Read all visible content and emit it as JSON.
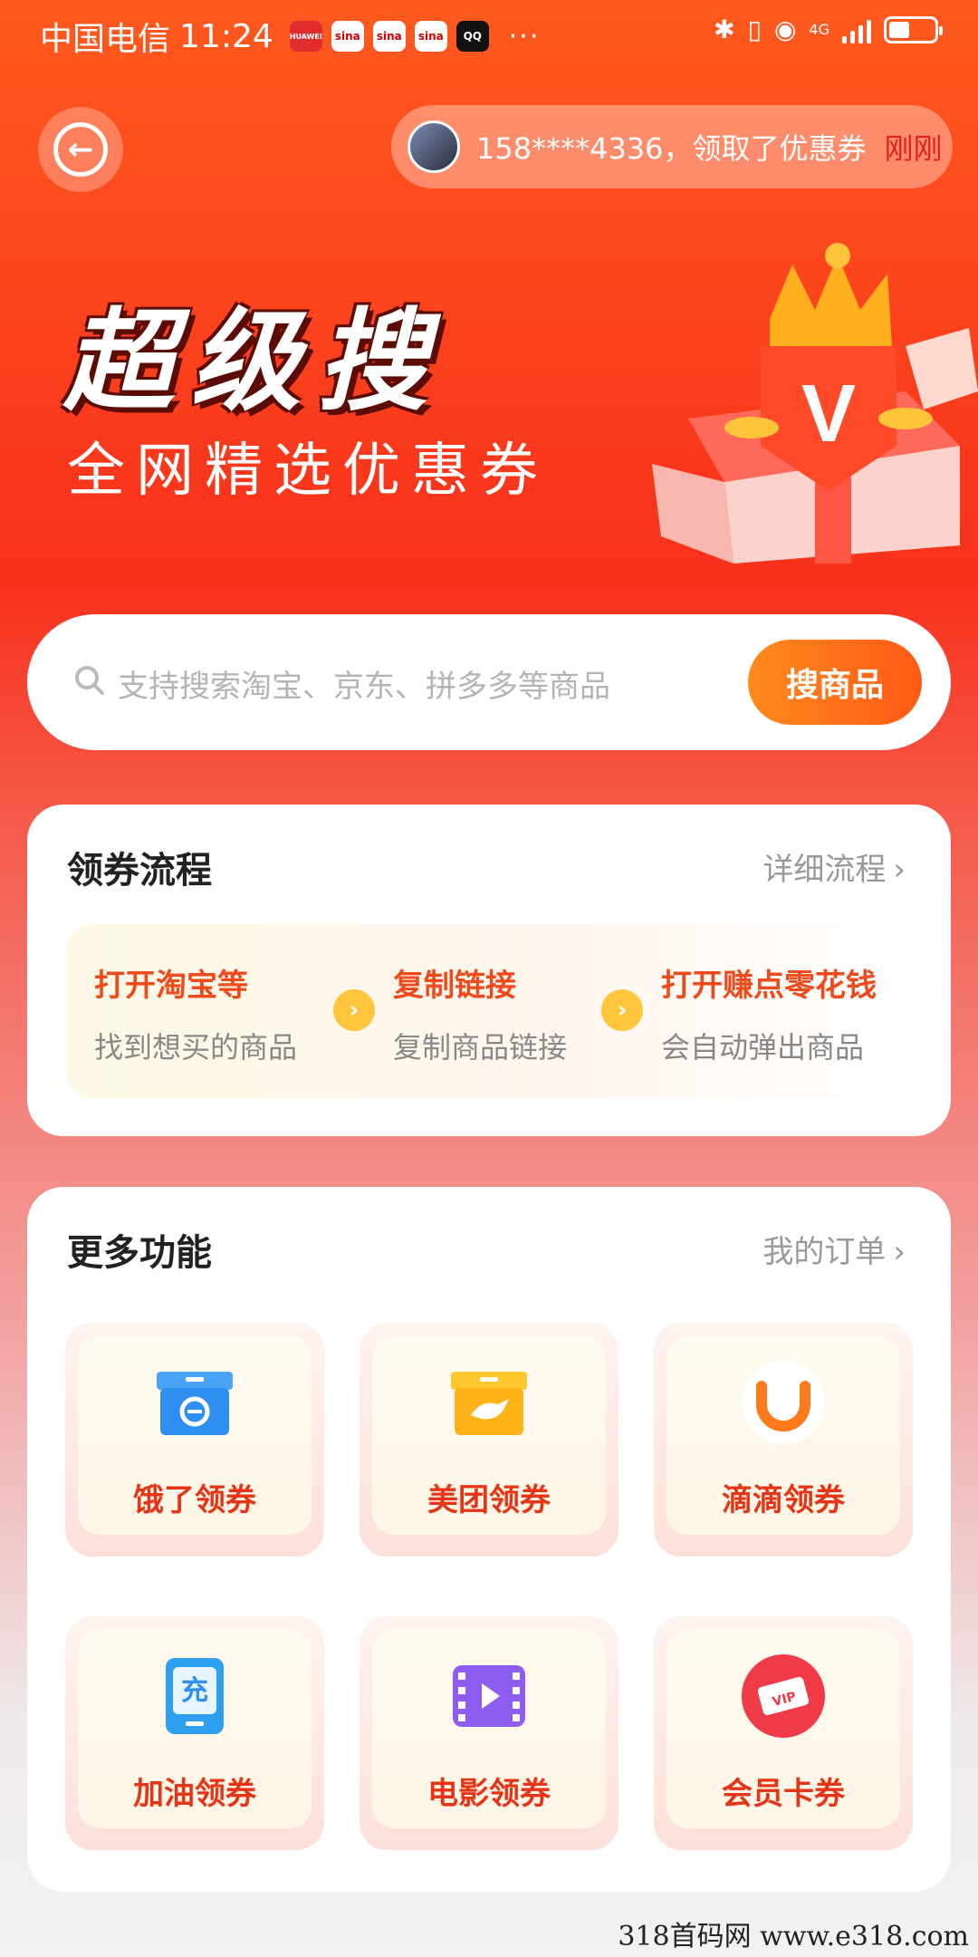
{
  "status_bar": {
    "carrier": "中国电信",
    "time": "11:24",
    "apps": [
      "HUAWEI",
      "sina",
      "sina",
      "sina",
      "QQ"
    ],
    "more": "···",
    "network": "4G"
  },
  "header": {
    "notice_text": "158****4336，领取了优惠券",
    "notice_tag": "刚刚"
  },
  "hero": {
    "title": "超级搜",
    "subtitle": "全网精选优惠券"
  },
  "search": {
    "placeholder": "支持搜索淘宝、京东、拼多多等商品",
    "button": "搜商品"
  },
  "flow_card": {
    "title": "领券流程",
    "link": "详细流程",
    "steps": [
      {
        "title": "打开淘宝等",
        "desc": "找到想买的商品"
      },
      {
        "title": "复制链接",
        "desc": "复制商品链接"
      },
      {
        "title": "打开赚点零花钱",
        "desc": "会自动弹出商品"
      }
    ]
  },
  "features_card": {
    "title": "更多功能",
    "link": "我的订单",
    "items": [
      {
        "label": "饿了领券",
        "icon": "ele-box-icon",
        "color": "#2f8ff0"
      },
      {
        "label": "美团领券",
        "icon": "meituan-kangaroo-icon",
        "color": "#ffb31a"
      },
      {
        "label": "滴滴领券",
        "icon": "didi-icon",
        "color": "#ff7a1a"
      },
      {
        "label": "加油领券",
        "icon": "recharge-icon",
        "color": "#2fa0f0"
      },
      {
        "label": "电影领券",
        "icon": "film-icon",
        "color": "#8f5cf0"
      },
      {
        "label": "会员卡券",
        "icon": "vip-ticket-icon",
        "color": "#f03a48"
      }
    ]
  },
  "watermark": "318首码网   www.e318.com"
}
